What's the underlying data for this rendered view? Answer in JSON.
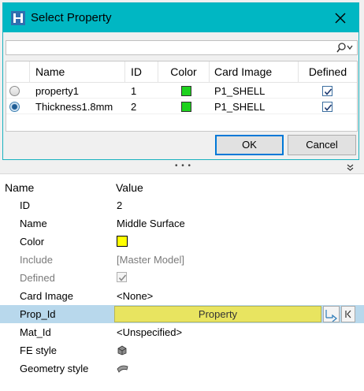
{
  "dialog": {
    "title": "Select Property",
    "columns": [
      "Name",
      "ID",
      "Color",
      "Card Image",
      "Defined"
    ],
    "rows": [
      {
        "selected": false,
        "name": "property1",
        "id": "1",
        "color": "#1ed21e",
        "card_image": "P1_SHELL",
        "defined": true
      },
      {
        "selected": true,
        "name": "Thickness1.8mm",
        "id": "2",
        "color": "#1ed21e",
        "card_image": "P1_SHELL",
        "defined": true
      }
    ],
    "ok_label": "OK",
    "cancel_label": "Cancel"
  },
  "splitter": {
    "dots": "• • •"
  },
  "panel": {
    "header_name": "Name",
    "header_value": "Value",
    "rows": {
      "id": {
        "label": "ID",
        "value": "2"
      },
      "name": {
        "label": "Name",
        "value": "Middle Surface"
      },
      "color": {
        "label": "Color",
        "value": "#ffff00"
      },
      "include": {
        "label": "Include",
        "value": "[Master Model]"
      },
      "defined": {
        "label": "Defined",
        "checked": true
      },
      "card_image": {
        "label": "Card Image",
        "value": "<None>"
      },
      "prop_id": {
        "label": "Prop_Id",
        "value": "Property"
      },
      "mat_id": {
        "label": "Mat_Id",
        "value": "<Unspecified>"
      },
      "fe_style": {
        "label": "FE style",
        "icon": "cube-shaded-icon"
      },
      "geometry_style": {
        "label": "Geometry style",
        "icon": "surface-shaded-icon"
      }
    }
  },
  "colors": {
    "titlebar": "#00b7c3",
    "selected_row": "#b8d8ec",
    "prop_field": "#e8e460"
  }
}
